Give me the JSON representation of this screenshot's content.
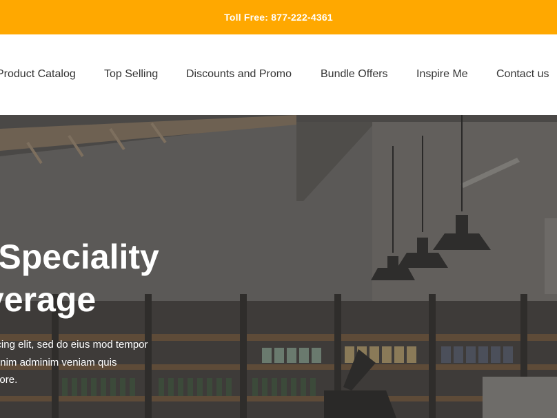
{
  "topbar": {
    "label": "Toll Free: 877-222-4361",
    "background": "#ffa800"
  },
  "nav": {
    "items": [
      {
        "label": "Product Catalog"
      },
      {
        "label": "Top Selling"
      },
      {
        "label": "Discounts and Promo"
      },
      {
        "label": "Bundle Offers"
      },
      {
        "label": "Inspire Me"
      },
      {
        "label": "Contact us"
      }
    ]
  },
  "hero": {
    "title_line1": "ale Speciality",
    "title_line2": "Beverage",
    "desc_line1": "t, consectetur adipiscing elit, sed do eius mod tempor",
    "desc_line2": "re magna aliqua. Utenim adminim veniam quis",
    "desc_line3": "npor incididunt ut labore."
  }
}
